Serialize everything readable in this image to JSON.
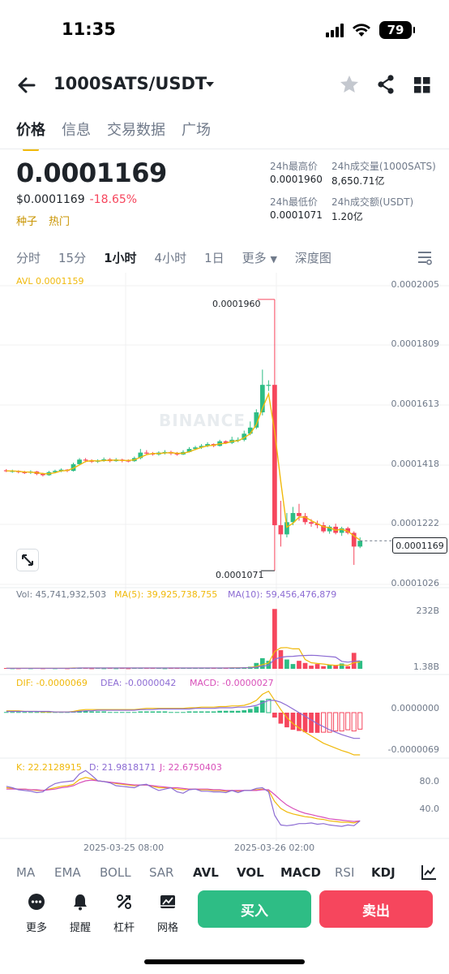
{
  "status_bar": {
    "time": "11:35",
    "battery": "79"
  },
  "header": {
    "pair": "1000SATS/USDT"
  },
  "tabs": [
    {
      "label": "价格",
      "active": true
    },
    {
      "label": "信息",
      "active": false
    },
    {
      "label": "交易数据",
      "active": false
    },
    {
      "label": "广场",
      "active": false
    }
  ],
  "price": {
    "last": "0.0001169",
    "usd": "$0.0001169",
    "change": "-18.65%",
    "tags": [
      "种子",
      "热门"
    ]
  },
  "stats": {
    "high_label": "24h最高价",
    "high_value": "0.0001960",
    "vol_base_label": "24h成交量(1000SATS)",
    "vol_base_value": "8,650.71亿",
    "low_label": "24h最低价",
    "low_value": "0.0001071",
    "vol_quote_label": "24h成交额(USDT)",
    "vol_quote_value": "1.20亿"
  },
  "intervals": [
    {
      "label": "分时",
      "active": false
    },
    {
      "label": "15分",
      "active": false
    },
    {
      "label": "1小时",
      "active": true
    },
    {
      "label": "4小时",
      "active": false
    },
    {
      "label": "1日",
      "active": false
    },
    {
      "label": "更多",
      "active": false,
      "dropdown": true
    },
    {
      "label": "深度图",
      "active": false
    }
  ],
  "chart_labels": {
    "avl": "AVL 0.0001159",
    "price_axis": [
      "0.0002005",
      "0.0001809",
      "0.0001613",
      "0.0001418",
      "0.0001222",
      "0.0001026"
    ],
    "current_price": "0.0001169",
    "high_marker": "0.0001960",
    "low_marker": "0.0001071",
    "watermark": "BINANCE",
    "vol": "Vol: 45,741,932,503",
    "vol_ma5": "MA(5): 39,925,738,755",
    "vol_ma10": "MA(10): 59,456,476,879",
    "vol_axis_top": "232B",
    "vol_axis_bottom": "1.38B",
    "dif": "DIF: -0.0000069",
    "dea": "DEA: -0.0000042",
    "macd": "MACD: -0.0000027",
    "macd_axis_top": "0.0000000",
    "macd_axis_bottom": "-0.0000069",
    "k": "K: 22.2128915",
    "d": "D: 21.9818171",
    "j": "J: 22.6750403",
    "kdj_axis_top": "80.0",
    "kdj_axis_bottom": "40.0",
    "dates": [
      "2025-03-25 08:00",
      "2025-03-26 02:00"
    ]
  },
  "indicators": [
    {
      "label": "MA",
      "on": false
    },
    {
      "label": "EMA",
      "on": false
    },
    {
      "label": "BOLL",
      "on": false
    },
    {
      "label": "SAR",
      "on": false
    },
    {
      "label": "AVL",
      "on": true
    },
    {
      "label": "VOL",
      "on": true
    },
    {
      "label": "MACD",
      "on": true
    },
    {
      "label": "RSI",
      "on": false
    },
    {
      "label": "KDJ",
      "on": true
    }
  ],
  "tools": [
    {
      "label": "更多",
      "icon": "more-icon"
    },
    {
      "label": "提醒",
      "icon": "bell-icon"
    },
    {
      "label": "杠杆",
      "icon": "leverage-icon"
    },
    {
      "label": "网格",
      "icon": "grid-trading-icon"
    }
  ],
  "actions": {
    "buy": "买入",
    "sell": "卖出"
  },
  "colors": {
    "up": "#2ebd85",
    "down": "#f6465d",
    "accent": "#f0b90b",
    "ma10": "#8c6bd3",
    "j_line": "#d84fb9"
  },
  "candles": {
    "o": [
      0.00014,
      0.0001398,
      0.0001398,
      0.0001394,
      0.0001392,
      0.0001396,
      0.0001388,
      0.0001384,
      0.0001394,
      0.0001398,
      0.0001402,
      0.0001398,
      0.000142,
      0.0001435,
      0.0001432,
      0.0001428,
      0.0001432,
      0.0001436,
      0.000143,
      0.0001435,
      0.0001432,
      0.000143,
      0.000144,
      0.0001458,
      0.0001455,
      0.0001452,
      0.0001458,
      0.000146,
      0.0001455,
      0.0001452,
      0.000146,
      0.000147,
      0.0001475,
      0.000148,
      0.0001486,
      0.000148,
      0.0001495,
      0.000149,
      0.00015,
      0.00015,
      0.000152,
      0.000154,
      0.000159,
      0.000168,
      0.000168,
      0.000122,
      0.000119,
      0.000123,
      0.000126,
      0.000125,
      0.000123,
      0.0001225,
      0.000122,
      0.00012,
      0.0001215,
      0.0001195,
      0.000121,
      0.0001195,
      0.000115
    ],
    "c": [
      0.0001398,
      0.0001398,
      0.0001394,
      0.0001392,
      0.0001396,
      0.0001388,
      0.0001384,
      0.0001394,
      0.0001398,
      0.0001402,
      0.0001398,
      0.000142,
      0.0001435,
      0.0001432,
      0.0001428,
      0.0001432,
      0.0001436,
      0.000143,
      0.0001435,
      0.0001432,
      0.000143,
      0.000144,
      0.0001458,
      0.0001455,
      0.0001452,
      0.0001458,
      0.000146,
      0.0001455,
      0.0001452,
      0.000146,
      0.000147,
      0.0001475,
      0.000148,
      0.0001486,
      0.000148,
      0.0001495,
      0.000149,
      0.00015,
      0.00015,
      0.000152,
      0.000154,
      0.000159,
      0.000168,
      0.000168,
      0.000122,
      0.000119,
      0.000123,
      0.000126,
      0.000125,
      0.000123,
      0.0001225,
      0.000122,
      0.00012,
      0.0001215,
      0.0001195,
      0.000121,
      0.0001195,
      0.000115,
      0.0001169
    ],
    "h": [
      0.0001404,
      0.0001402,
      0.00014,
      0.0001398,
      0.00014,
      0.0001398,
      0.0001392,
      0.0001398,
      0.0001402,
      0.0001406,
      0.0001404,
      0.0001425,
      0.000144,
      0.000144,
      0.0001436,
      0.0001436,
      0.0001442,
      0.000144,
      0.000144,
      0.0001438,
      0.0001436,
      0.0001445,
      0.000147,
      0.0001466,
      0.000146,
      0.0001462,
      0.0001466,
      0.0001464,
      0.000146,
      0.0001466,
      0.0001476,
      0.000148,
      0.0001486,
      0.0001492,
      0.0001488,
      0.00015,
      0.0001498,
      0.000151,
      0.0001508,
      0.000153,
      0.000156,
      0.00016,
      0.000173,
      0.0001695,
      0.000196,
      0.00013,
      0.000126,
      0.000128,
      0.000129,
      0.000126,
      0.000124,
      0.0001235,
      0.000123,
      0.000122,
      0.0001225,
      0.0001215,
      0.0001215,
      0.00012,
      0.000118
    ],
    "l": [
      0.0001394,
      0.0001392,
      0.000139,
      0.0001388,
      0.0001388,
      0.0001384,
      0.000138,
      0.0001382,
      0.000139,
      0.0001394,
      0.0001394,
      0.0001396,
      0.0001418,
      0.0001426,
      0.0001424,
      0.0001424,
      0.0001428,
      0.0001426,
      0.0001428,
      0.0001426,
      0.0001426,
      0.0001428,
      0.0001436,
      0.000145,
      0.0001448,
      0.0001448,
      0.0001452,
      0.000145,
      0.0001448,
      0.000145,
      0.0001458,
      0.0001466,
      0.000147,
      0.0001476,
      0.0001476,
      0.0001478,
      0.0001486,
      0.0001486,
      0.0001492,
      0.0001495,
      0.0001515,
      0.0001535,
      0.000158,
      0.000166,
      0.0001071,
      0.000115,
      0.000118,
      0.000122,
      0.0001235,
      0.0001222,
      0.0001215,
      0.000121,
      0.0001195,
      0.0001192,
      0.000119,
      0.0001185,
      0.000119,
      0.000109,
      0.0001145
    ]
  },
  "volume": [
    3,
    2,
    2,
    3,
    2,
    3,
    2,
    3,
    2,
    3,
    2,
    4,
    3,
    3,
    2,
    3,
    2,
    3,
    2,
    3,
    2,
    3,
    4,
    3,
    3,
    3,
    2,
    3,
    3,
    3,
    4,
    3,
    3,
    4,
    3,
    4,
    3,
    4,
    3,
    6,
    8,
    22,
    40,
    30,
    225,
    70,
    35,
    18,
    30,
    22,
    12,
    18,
    10,
    14,
    12,
    20,
    10,
    60,
    30
  ],
  "vol_ma5": [
    2,
    2,
    2,
    2,
    2,
    2,
    2,
    2,
    2,
    2,
    2,
    3,
    3,
    3,
    3,
    3,
    3,
    3,
    3,
    3,
    3,
    3,
    3,
    3,
    3,
    3,
    3,
    3,
    3,
    3,
    3,
    3,
    3,
    3,
    3,
    3,
    3,
    4,
    4,
    4,
    5,
    9,
    16,
    22,
    65,
    79,
    80,
    75,
    75,
    35,
    23,
    20,
    18,
    15,
    13,
    15,
    13,
    23,
    26
  ],
  "vol_ma10": [
    2,
    2,
    2,
    2,
    2,
    2,
    2,
    2,
    2,
    2,
    2,
    2,
    3,
    3,
    3,
    3,
    3,
    3,
    3,
    3,
    3,
    3,
    3,
    3,
    3,
    3,
    3,
    3,
    3,
    3,
    3,
    3,
    3,
    3,
    3,
    3,
    3,
    3,
    3,
    4,
    4,
    6,
    10,
    13,
    36,
    43,
    46,
    47,
    49,
    50,
    51,
    50,
    48,
    46,
    44,
    28,
    25,
    28,
    30
  ],
  "macd_hist": [
    0.1,
    0.1,
    0.1,
    0.1,
    0.1,
    0.1,
    0.1,
    0.1,
    0.1,
    0.1,
    0.1,
    0.2,
    0.3,
    0.3,
    0.2,
    0.2,
    0.2,
    0.1,
    0.1,
    0.1,
    0.1,
    0.1,
    0.2,
    0.2,
    0.2,
    0.2,
    0.2,
    0.1,
    0.1,
    0.1,
    0.2,
    0.2,
    0.2,
    0.2,
    0.2,
    0.3,
    0.3,
    0.3,
    0.3,
    0.4,
    0.6,
    1.0,
    2.0,
    2.2,
    -0.8,
    -1.8,
    -2.4,
    -2.8,
    -3.0,
    -3.2,
    -3.3,
    -3.3,
    -3.2,
    -3.2,
    -3.0,
    -3.0,
    -2.8,
    -3.0,
    -2.7
  ],
  "dif": [
    0.3,
    0.3,
    0.3,
    0.2,
    0.2,
    0.2,
    0.1,
    0.1,
    0.1,
    0.1,
    0.1,
    0.2,
    0.4,
    0.5,
    0.5,
    0.5,
    0.5,
    0.5,
    0.5,
    0.5,
    0.5,
    0.5,
    0.6,
    0.7,
    0.7,
    0.7,
    0.7,
    0.7,
    0.7,
    0.7,
    0.8,
    0.8,
    0.9,
    0.9,
    0.9,
    1.0,
    1.0,
    1.1,
    1.1,
    1.2,
    1.5,
    2.0,
    3.0,
    3.5,
    2.0,
    0.5,
    -0.8,
    -1.8,
    -2.5,
    -3.2,
    -3.8,
    -4.4,
    -5.0,
    -5.4,
    -5.8,
    -6.2,
    -6.5,
    -6.9,
    -6.9
  ],
  "dea": [
    0.2,
    0.2,
    0.2,
    0.2,
    0.2,
    0.2,
    0.2,
    0.2,
    0.1,
    0.1,
    0.1,
    0.1,
    0.2,
    0.3,
    0.3,
    0.4,
    0.4,
    0.4,
    0.4,
    0.4,
    0.4,
    0.4,
    0.5,
    0.5,
    0.5,
    0.6,
    0.6,
    0.6,
    0.6,
    0.6,
    0.6,
    0.7,
    0.7,
    0.7,
    0.7,
    0.8,
    0.8,
    0.8,
    0.9,
    0.9,
    1.0,
    1.2,
    1.6,
    2.0,
    2.0,
    1.7,
    1.2,
    0.6,
    0.0,
    -0.6,
    -1.2,
    -1.8,
    -2.3,
    -2.8,
    -3.2,
    -3.6,
    -3.9,
    -4.2,
    -4.2
  ],
  "kdj_k": [
    70,
    69,
    68,
    68,
    67,
    66,
    66,
    68,
    70,
    72,
    73,
    75,
    82,
    85,
    83,
    80,
    79,
    78,
    76,
    75,
    74,
    73,
    74,
    74,
    72,
    70,
    70,
    70,
    68,
    67,
    68,
    68,
    67,
    67,
    66,
    66,
    65,
    66,
    65,
    66,
    66,
    67,
    68,
    66,
    50,
    40,
    35,
    32,
    30,
    28,
    27,
    25,
    24,
    22,
    21,
    20,
    20,
    19,
    22
  ],
  "kdj_d": [
    68,
    68,
    68,
    68,
    67,
    67,
    66,
    67,
    68,
    70,
    71,
    73,
    77,
    80,
    81,
    80,
    79,
    78,
    77,
    76,
    75,
    74,
    74,
    74,
    73,
    72,
    71,
    70,
    70,
    69,
    68,
    68,
    68,
    68,
    67,
    67,
    66,
    66,
    66,
    66,
    66,
    66,
    67,
    67,
    60,
    52,
    45,
    40,
    36,
    33,
    31,
    29,
    27,
    25,
    24,
    23,
    22,
    21,
    22
  ],
  "kdj_j": [
    72,
    70,
    67,
    66,
    65,
    63,
    64,
    71,
    76,
    78,
    79,
    80,
    90,
    95,
    88,
    80,
    79,
    77,
    73,
    72,
    71,
    70,
    74,
    75,
    70,
    66,
    68,
    70,
    64,
    62,
    67,
    68,
    65,
    65,
    64,
    64,
    63,
    66,
    63,
    66,
    66,
    69,
    70,
    64,
    30,
    16,
    15,
    16,
    18,
    18,
    19,
    17,
    18,
    16,
    15,
    14,
    16,
    15,
    22
  ]
}
